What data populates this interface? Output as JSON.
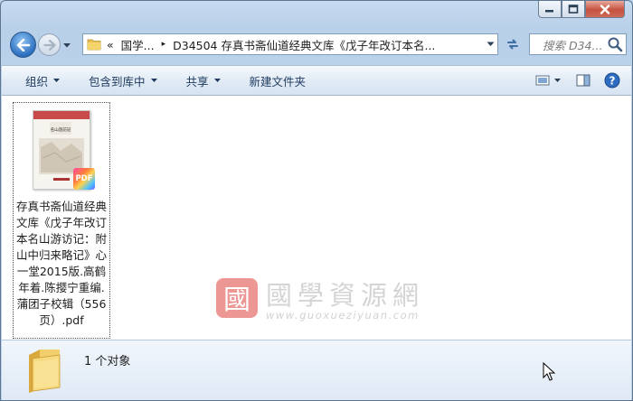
{
  "window": {
    "caption_buttons": [
      {
        "name": "minimize",
        "icon": "minimize-icon"
      },
      {
        "name": "maximize",
        "icon": "maximize-icon"
      },
      {
        "name": "close",
        "icon": "close-icon"
      }
    ]
  },
  "navigation": {
    "back_icon": "back-arrow-icon",
    "forward_icon": "forward-arrow-icon",
    "address": {
      "overflow_chevron": "«",
      "crumb_parent": "国学...",
      "separator": "▸",
      "crumb_current": "D34504 存真书斋仙道经典文库《戊子年改订本名..."
    },
    "search": {
      "placeholder": "搜索 D34..."
    }
  },
  "toolbar": {
    "organize": "组织",
    "include_in_library": "包含到库中",
    "share": "共享",
    "new_folder": "新建文件夹",
    "right_icons": [
      "view-options-icon",
      "preview-pane-icon",
      "help-icon"
    ]
  },
  "files": [
    {
      "name": "存真书斋仙道经典文库《戊子年改订本名山游访记：附山中归来略记》心一堂2015版.高鹤年着.陈撄宁重编.蒲团子校辑（556页）.pdf",
      "badge": "PDF",
      "cover_title": "名山遊訪記",
      "selected": true
    }
  ],
  "watermark": {
    "title": "國學資源網",
    "url": "www.guoxueziyuan.com"
  },
  "details": {
    "count_text": "1 个对象"
  },
  "colors": {
    "accent": "#2c6fc0",
    "close_button": "#c4523f",
    "toolbar_text": "#1e3a5f",
    "watermark_red": "#d9534f"
  }
}
